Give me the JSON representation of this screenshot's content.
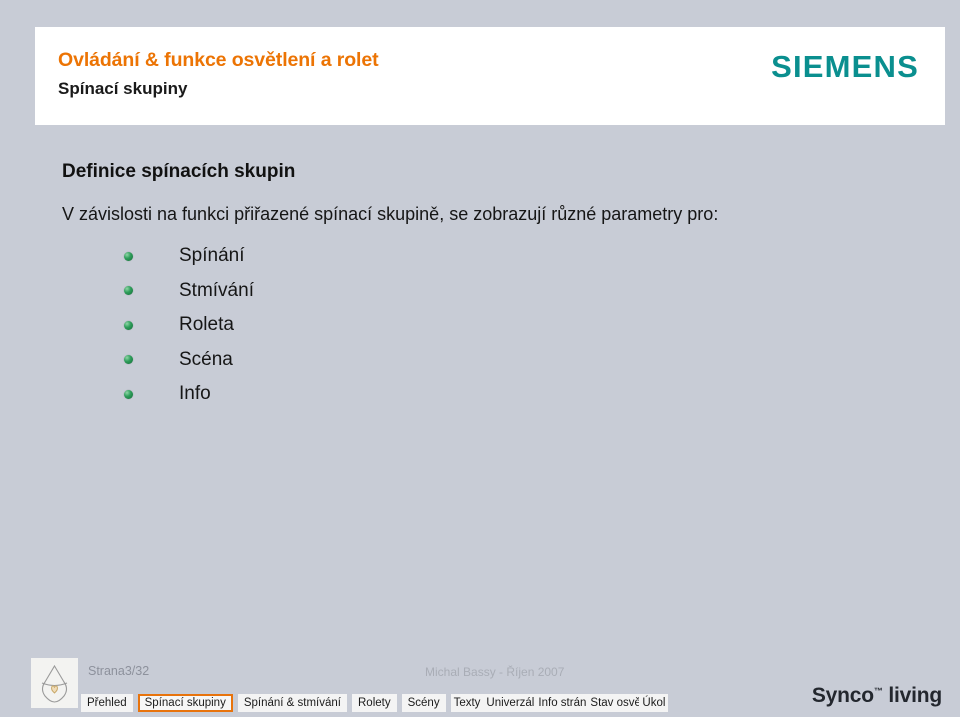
{
  "header": {
    "title_main": "Ovládání & funkce osvětlení a rolet",
    "title_sub": "Spínací skupiny",
    "brand_logo": "SIEMENS",
    "brand_color": "#0a8f8f",
    "accent_color": "#ec7404"
  },
  "main": {
    "heading": "Definice spínacích skupin",
    "paragraph": "V závislosti na funkci přiřazené spínací skupině, se zobrazují různé parametry pro:",
    "bullets": [
      {
        "label": "Spínání"
      },
      {
        "label": "Stmívání"
      },
      {
        "label": "Roleta"
      },
      {
        "label": "Scéna"
      },
      {
        "label": "Info"
      }
    ]
  },
  "footer": {
    "page_number": "Strana3/32",
    "author_date": "Michal Bassy - Říjen 2007",
    "product_logo": "Synco",
    "product_logo_tm": "™",
    "product_logo_suffix": " living",
    "logo_icon": "house-heart-icon",
    "nav": {
      "active_index": 1,
      "active_border_color": "#e8730c",
      "items": [
        {
          "label": "Přehled"
        },
        {
          "label": "Spínací skupiny"
        },
        {
          "label": "Spínání & stmívání"
        },
        {
          "label": "Rolety"
        },
        {
          "label": "Scény"
        },
        {
          "label": "Texty"
        },
        {
          "label": "Univerzální klávesnice"
        },
        {
          "label": "Info stránky"
        },
        {
          "label": "Stav osvětlení"
        },
        {
          "label": "Úkol"
        }
      ]
    }
  }
}
